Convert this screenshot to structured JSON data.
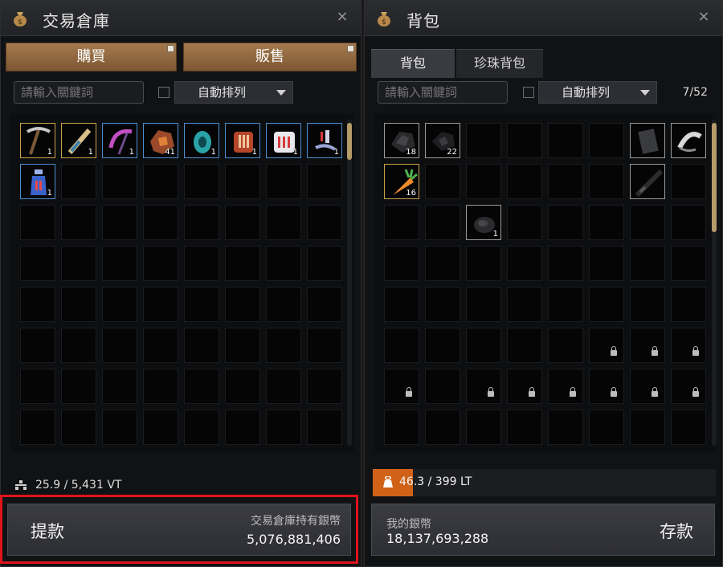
{
  "left_window": {
    "title": "交易倉庫",
    "close_glyph": "×",
    "buy_label": "購買",
    "sell_label": "販售",
    "search_placeholder": "請輸入關鍵詞",
    "sort_label": "自動排列",
    "items": [
      {
        "icon": "pickaxe-icon",
        "qty": "1",
        "frame": "gold"
      },
      {
        "icon": "feather-knife-icon",
        "qty": "1",
        "frame": "gold"
      },
      {
        "icon": "sickle-icon",
        "qty": "1",
        "frame": "blue"
      },
      {
        "icon": "ore-chunk-icon",
        "qty": "41",
        "frame": "blue"
      },
      {
        "icon": "egg-icon",
        "qty": "1",
        "frame": "blue"
      },
      {
        "icon": "armor-icon",
        "qty": "1",
        "frame": "blue"
      },
      {
        "icon": "clothing-icon",
        "qty": "1",
        "frame": "blue"
      },
      {
        "icon": "potion-spoon-icon",
        "qty": "1",
        "frame": "blue"
      },
      {
        "icon": "elixir-bottle-icon",
        "qty": "1",
        "frame": "blue"
      }
    ],
    "weight_text": "25.9 / 5,431 VT",
    "withdraw_label": "提款",
    "silver_label": "交易倉庫持有銀幣",
    "silver_value": "5,076,881,406"
  },
  "right_window": {
    "title": "背包",
    "close_glyph": "×",
    "tabs": [
      {
        "label": "背包",
        "active": true
      },
      {
        "label": "珍珠背包",
        "active": false
      }
    ],
    "search_placeholder": "請輸入關鍵詞",
    "sort_label": "自動排列",
    "slot_count": "7/52",
    "items": [
      {
        "slot": 0,
        "icon": "dark-ore-icon",
        "qty": "18"
      },
      {
        "slot": 1,
        "icon": "black-stone-icon",
        "qty": "22"
      },
      {
        "slot": 6,
        "icon": "scroll-icon",
        "qty": ""
      },
      {
        "slot": 7,
        "icon": "horn-icon",
        "qty": ""
      },
      {
        "slot": 8,
        "icon": "carrot-icon",
        "qty": "16"
      },
      {
        "slot": 14,
        "icon": "dagger-icon",
        "qty": ""
      },
      {
        "slot": 18,
        "icon": "rock-icon",
        "qty": "1"
      }
    ],
    "locked_slots": [
      45,
      46,
      47,
      48,
      50,
      51,
      52,
      53,
      54,
      55
    ],
    "weight_text": "46.3 / 399 LT",
    "weight_fraction": 0.116,
    "my_silver_label": "我的銀幣",
    "my_silver_value": "18,137,693,288",
    "deposit_label": "存款"
  },
  "colors": {
    "accent_orange": "#d06218",
    "button_brown": "#a57a4e",
    "highlight_red": "#e0131b"
  }
}
